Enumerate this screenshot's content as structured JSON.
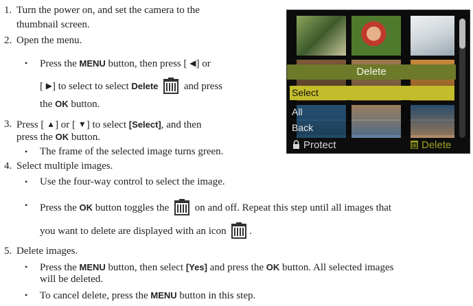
{
  "steps": {
    "s1": {
      "num": "1.",
      "l1": "Turn the power on, and set the camera to the",
      "l2": "thumbnail screen."
    },
    "s2": {
      "num": "2.",
      "text": "Open the menu.",
      "b1_l1_a": "Press the ",
      "b1_l1_btn": "MENU",
      "b1_l1_b": " button, then press [ ",
      "b1_l1_left": "◀",
      "b1_l1_c": "] or",
      "b1_l2_a": "[ ",
      "b1_l2_right": "▶",
      "b1_l2_b": "] to select to select ",
      "b1_l2_bold": "Delete",
      "b1_l2_c": " and press",
      "b1_l3_a": "the ",
      "b1_l3_btn": "OK",
      "b1_l3_b": " button."
    },
    "s3": {
      "num": "3.",
      "l1_a": "Press [ ",
      "l1_up": "▲",
      "l1_b": "] or [ ",
      "l1_down": "▼",
      "l1_c": "] to select ",
      "l1_bold": "[Select]",
      "l1_d": ", and then",
      "l2_a": "press the ",
      "l2_btn": "OK",
      "l2_b": " button.",
      "b1": "The frame of the selected image turns green."
    },
    "s4": {
      "num": "4.",
      "text": "Select multiple images.",
      "b1": "Use the four-way control to select the image.",
      "b2_a": "Press the ",
      "b2_btn": "OK",
      "b2_b": " button toggles the ",
      "b2_c": " on and off. Repeat this step until all images that",
      "b2_l2": "you want to delete are displayed with an icon ",
      "b2_l2_end": "."
    },
    "s5": {
      "num": "5.",
      "text": "Delete images.",
      "b1_a": "Press the ",
      "b1_btn": "MENU",
      "b1_b": " button, then select ",
      "b1_bold": "[Yes]",
      "b1_c": " and press the ",
      "b1_btn2": "OK",
      "b1_d": " button. All selected images",
      "b1_l2": "will be deleted.",
      "b2_a": "To cancel delete, press the ",
      "b2_btn": "MENU",
      "b2_b": " button in this step."
    }
  },
  "icons": {
    "trash": "trash-can-icon",
    "lock": "lock-icon",
    "bullet": "•"
  },
  "lcd": {
    "menu_title": "Delete",
    "items": [
      "Select",
      "All",
      "Back"
    ],
    "protect_label": "Protect",
    "delete_label": "Delete",
    "colors": {
      "menu_header": "#6c7a2a",
      "selected": "#c4bd2b",
      "footer_delete": "#9aa21f"
    }
  }
}
